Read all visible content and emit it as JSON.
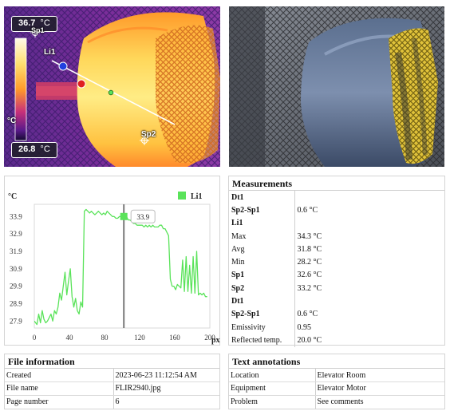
{
  "thermal_image": {
    "max_temp": "36.7",
    "min_temp": "26.8",
    "unit": "°C",
    "scale_unit": "°C",
    "markers": {
      "line": "Li1",
      "spot1": "Sp1",
      "spot2": "Sp2"
    }
  },
  "chart": {
    "y_unit": "°C",
    "x_unit": "px",
    "legend_label": "Li1",
    "cursor_value": "33.9"
  },
  "chart_data": {
    "type": "line",
    "series": [
      {
        "name": "Li1",
        "color": "#5ae35a",
        "x": [
          0,
          3,
          5,
          7,
          9,
          11,
          13,
          15,
          17,
          19,
          21,
          23,
          25,
          27,
          29,
          31,
          33,
          35,
          37,
          39,
          41,
          43,
          45,
          47,
          49,
          51,
          53,
          55,
          57,
          59,
          61,
          63,
          65,
          67,
          69,
          71,
          73,
          75,
          77,
          79,
          81,
          83,
          85,
          87,
          89,
          91,
          93,
          95,
          97,
          99,
          101,
          103,
          105,
          107,
          109,
          111,
          113,
          115,
          117,
          119,
          121,
          123,
          125,
          127,
          129,
          131,
          133,
          135,
          137,
          139,
          141,
          143,
          145,
          147,
          149,
          151,
          153,
          155,
          157,
          159,
          161,
          163,
          165,
          167,
          169,
          171,
          173,
          175,
          177,
          179,
          181,
          183,
          185,
          187,
          189,
          191,
          193,
          195,
          197
        ],
        "values": [
          27.9,
          27.7,
          28.3,
          27.8,
          28.5,
          28.0,
          27.8,
          27.9,
          28.1,
          28.3,
          27.9,
          28.5,
          28.3,
          28.7,
          29.5,
          29.1,
          29.9,
          30.7,
          29.4,
          30.2,
          30.9,
          29.3,
          28.7,
          29.2,
          28.5,
          28.3,
          29.0,
          28.7,
          34.2,
          34.3,
          34.2,
          34.1,
          34.2,
          34.1,
          34.0,
          34.1,
          34.2,
          34.1,
          34.0,
          34.1,
          34.0,
          34.2,
          34.1,
          34.0,
          33.9,
          33.9,
          33.8,
          33.8,
          33.9,
          33.9,
          33.9,
          33.8,
          33.9,
          33.7,
          33.7,
          33.6,
          33.5,
          33.5,
          33.4,
          33.4,
          33.4,
          33.4,
          33.3,
          33.4,
          33.3,
          33.4,
          33.3,
          33.4,
          33.3,
          33.3,
          33.3,
          33.4,
          33.4,
          33.2,
          33.2,
          33.0,
          32.8,
          30.3,
          29.9,
          29.9,
          29.7,
          30.0,
          29.9,
          29.8,
          31.4,
          29.6,
          31.6,
          29.6,
          31.1,
          29.5,
          31.6,
          29.5,
          31.9,
          29.4,
          29.5,
          29.4,
          29.5,
          29.3,
          29.3
        ]
      }
    ],
    "xlim": [
      0,
      200
    ],
    "ylim": [
      27.5,
      34.6
    ],
    "x_ticks": [
      0,
      40,
      80,
      120,
      160,
      200
    ],
    "y_ticks": [
      27.9,
      28.9,
      29.9,
      30.9,
      31.9,
      32.9,
      33.9
    ],
    "x_cursor": 102,
    "grid": false
  },
  "measurements": {
    "title": "Measurements",
    "rows": [
      {
        "label": "Dt1",
        "value": "",
        "bold": true
      },
      {
        "label": "Sp2-Sp1",
        "value": "0.6 °C",
        "bold": true
      },
      {
        "label": "Li1",
        "value": "",
        "bold": true
      },
      {
        "label": "Max",
        "value": "34.3 °C",
        "bold": false
      },
      {
        "label": "Avg",
        "value": "31.8 °C",
        "bold": false
      },
      {
        "label": "Min",
        "value": "28.2 °C",
        "bold": false
      },
      {
        "label": "Sp1",
        "value": "32.6 °C",
        "bold": true
      },
      {
        "label": "Sp2",
        "value": "33.2 °C",
        "bold": true
      },
      {
        "label": "Dt1",
        "value": "",
        "bold": true
      },
      {
        "label": "Sp2-Sp1",
        "value": "0.6 °C",
        "bold": true
      },
      {
        "label": "Emissivity",
        "value": "0.95",
        "bold": false
      },
      {
        "label": "Reflected temp.",
        "value": "20.0 °C",
        "bold": false
      }
    ]
  },
  "file_info": {
    "title": "File information",
    "rows": [
      {
        "label": "Created",
        "value": "2023-06-23 11:12:54 AM"
      },
      {
        "label": "File name",
        "value": "FLIR2940.jpg"
      },
      {
        "label": "Page number",
        "value": "6"
      }
    ]
  },
  "text_annotations": {
    "title": "Text annotations",
    "rows": [
      {
        "label": "Location",
        "value": "Elevator Room"
      },
      {
        "label": "Equipment",
        "value": "Elevator Motor"
      },
      {
        "label": "Problem",
        "value": "See comments"
      }
    ]
  },
  "colors": {
    "line_series": "#5ae35a",
    "panel_border": "#d4d4d4",
    "thermal_hot": "#ffe47a",
    "thermal_cold": "#3a1670"
  }
}
